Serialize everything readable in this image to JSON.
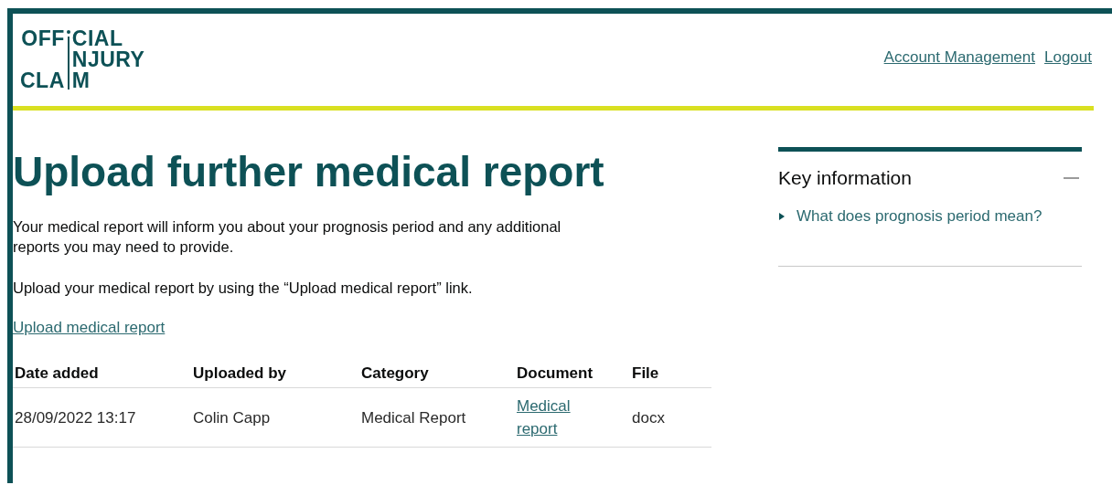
{
  "logo": {
    "rows": [
      {
        "before": "OFF",
        "after": "CIAL"
      },
      {
        "after": "NJURY"
      },
      {
        "before": "CLA",
        "after": "M"
      }
    ]
  },
  "header_links": [
    "Account Management",
    "Logout"
  ],
  "title": "Upload further medical report",
  "paragraphs": [
    "Your medical report will inform you about your prognosis period and any additional reports you may need to provide.",
    "Upload your medical report by using the “Upload medical report” link."
  ],
  "upload_link": "Upload medical report",
  "table": {
    "columns": [
      "Date added",
      "Uploaded by",
      "Category",
      "Document",
      "File"
    ],
    "rows": [
      {
        "date_added": "28/09/2022 13:17",
        "uploaded_by": "Colin Capp",
        "category": "Medical Report",
        "document": "Medical report",
        "file": "docx"
      }
    ]
  },
  "key_information": {
    "title": "Key information",
    "expanded": true,
    "items": [
      {
        "label": "What does prognosis period mean?",
        "open": false
      }
    ]
  }
}
